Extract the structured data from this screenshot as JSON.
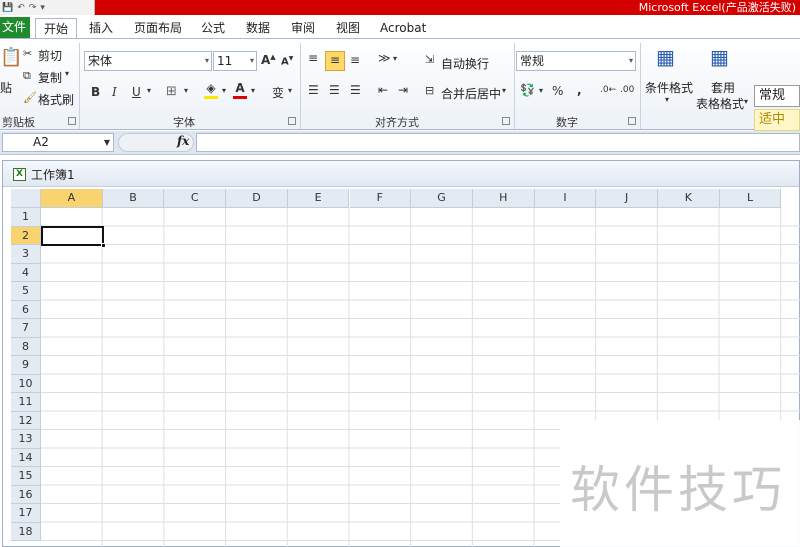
{
  "window": {
    "title": "Microsoft Excel(产品激活失败)"
  },
  "qat": {
    "items": [
      "💾",
      "↶",
      "↷",
      "▾"
    ]
  },
  "tabs": [
    {
      "label": "文件"
    },
    {
      "label": "开始"
    },
    {
      "label": "插入"
    },
    {
      "label": "页面布局"
    },
    {
      "label": "公式"
    },
    {
      "label": "数据"
    },
    {
      "label": "审阅"
    },
    {
      "label": "视图"
    },
    {
      "label": "Acrobat"
    }
  ],
  "ribbon": {
    "clipboard": {
      "paste": "贴",
      "cut": "剪切",
      "copy": "复制",
      "format_painter": "格式刷",
      "label": "剪贴板"
    },
    "font": {
      "name": "宋体",
      "size": "11",
      "bold": "B",
      "italic": "I",
      "underline": "U",
      "wen": "变",
      "label": "字体"
    },
    "alignment": {
      "wrap": "自动换行",
      "merge": "合并后居中",
      "label": "对齐方式"
    },
    "number": {
      "format": "常规",
      "percent": "%",
      "comma": ",",
      "label": "数字"
    },
    "styles": {
      "conditional": "条件格式",
      "table_1": "套用",
      "table_2": "表格格式",
      "normal": "常规",
      "neutral": "适中"
    }
  },
  "formula_bar": {
    "name_box": "A2",
    "fx": "fx",
    "value": ""
  },
  "workbook": {
    "name": "工作簿1",
    "columns": [
      "A",
      "B",
      "C",
      "D",
      "E",
      "F",
      "G",
      "H",
      "I",
      "J",
      "K",
      "L"
    ],
    "rows": [
      "1",
      "2",
      "3",
      "4",
      "5",
      "6",
      "7",
      "8",
      "9",
      "10",
      "11",
      "12",
      "13",
      "14",
      "15",
      "16",
      "17",
      "18"
    ],
    "selected_column": "A",
    "selected_row": "2"
  },
  "watermark": "软件技巧",
  "colors": {
    "title_bar": "#d40000",
    "file_tab": "#1f8a2e",
    "selection_header": "#f8d36f"
  }
}
